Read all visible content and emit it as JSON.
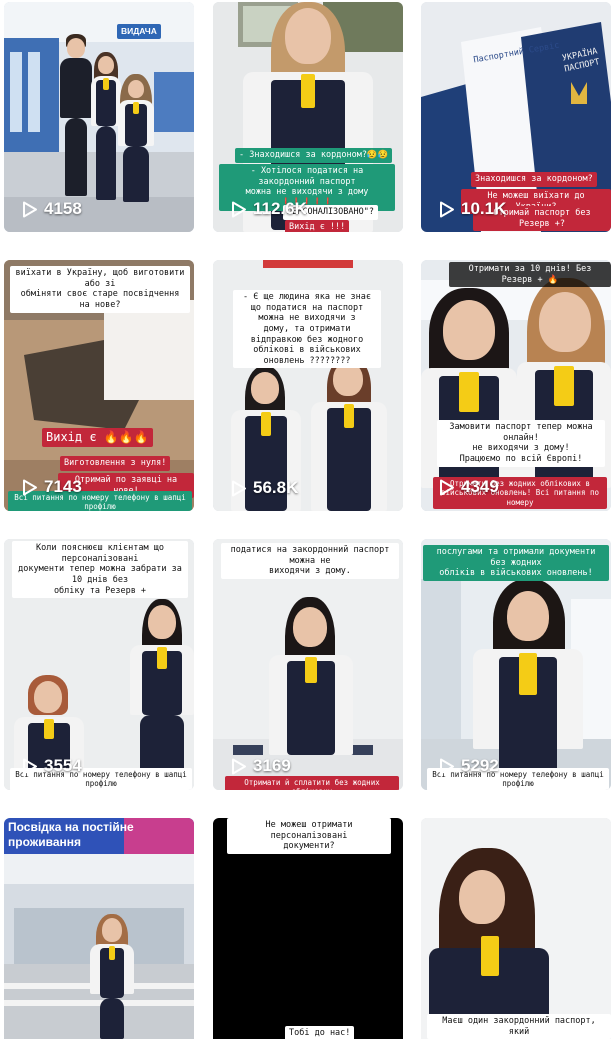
{
  "colors": {
    "caption_green": "#1f9a78",
    "caption_red": "#c2273a",
    "uniform_navy": "#1d2238",
    "tie_yellow": "#f4cc16"
  },
  "icons": {
    "play": "play-icon"
  },
  "videos": [
    {
      "views": "4158",
      "captions": [
        {
          "text": "ВИДАЧА"
        }
      ]
    },
    {
      "views": "112.6K",
      "captions": [
        {
          "text": "- Знаходишся за кордоном?😥😥"
        },
        {
          "text": "- Хотілося податися на закордонний паспорт\nможна не виходячи з дому ❗❗❗❗❗"
        },
        {
          "text": "ПЕРСОНАЛІЗОВАНО\"?"
        },
        {
          "text": "Вихід є !!!"
        }
      ]
    },
    {
      "views": "10.1K",
      "captions": [
        {
          "text": "УКРАЇНА ПАСПОРТ"
        },
        {
          "text": "Паспортний Сервіс"
        },
        {
          "text": "Знаходишся за кордоном?"
        },
        {
          "text": "Не можеш виїхати до України?"
        },
        {
          "text": "Отримай паспорт без Резерв +?"
        }
      ]
    },
    {
      "views": "7143",
      "captions": [
        {
          "text": "виїхати в Україну, щоб виготовити або зі\nобміняти своє старе посвідчення на нове?"
        },
        {
          "text": "Вихід є 🔥🔥🔥"
        },
        {
          "text": "Виготовлення з нуля!"
        },
        {
          "text": "Отримай по заявці на нове!"
        },
        {
          "text": "Всі питання по номеру телефону в шапці профілю"
        }
      ]
    },
    {
      "views": "56.8K",
      "captions": [
        {
          "text": "- Є ще людина яка не знає\nщо податися на паспорт можна не виходячи з\nдому, та отримати відправкою без жодного\nоблікові в військових оновлень ????????"
        }
      ]
    },
    {
      "views": "4349",
      "captions": [
        {
          "text": "Отримати за 10 днів! Без Резерв + 🔥"
        },
        {
          "text": "Замовити паспорт тепер можна онлайн!\nне виходячи з дому!\nПрацюємо по всій Європі!"
        },
        {
          "text": "Отримати без жодних облікових в\nвійськових оновлень! Всі питання по номеру"
        }
      ]
    },
    {
      "views": "3554",
      "captions": [
        {
          "text": "Коли пояснюєш клієнтам що персоналізовані\nдокументи тепер можна забрати за 10 днів без\nобліку та Резерв +"
        },
        {
          "text": "Всі питання по номеру телефону в шапці профілю"
        }
      ]
    },
    {
      "views": "3169",
      "captions": [
        {
          "text": "податися на закордонний паспорт можна не\nвиходячи з дому."
        },
        {
          "text": "Отримати й сплатити без жодних облікових"
        }
      ]
    },
    {
      "views": "5292",
      "captions": [
        {
          "text": "послугами та отримали документи без жодних\nобліків в військових оновлень!"
        },
        {
          "text": "Всі питання по номеру телефону в шапці профілю"
        }
      ]
    },
    {
      "views": "",
      "captions": [
        {
          "text": "Посвідка на постійне\nпроживання"
        }
      ]
    },
    {
      "views": "",
      "captions": [
        {
          "text": "Не можеш отримати персоналізовані\nдокументи?"
        },
        {
          "text": "Тобі до нас!"
        }
      ]
    },
    {
      "views": "",
      "captions": [
        {
          "text": "Маєш один закордонний паспорт, який"
        }
      ]
    }
  ]
}
